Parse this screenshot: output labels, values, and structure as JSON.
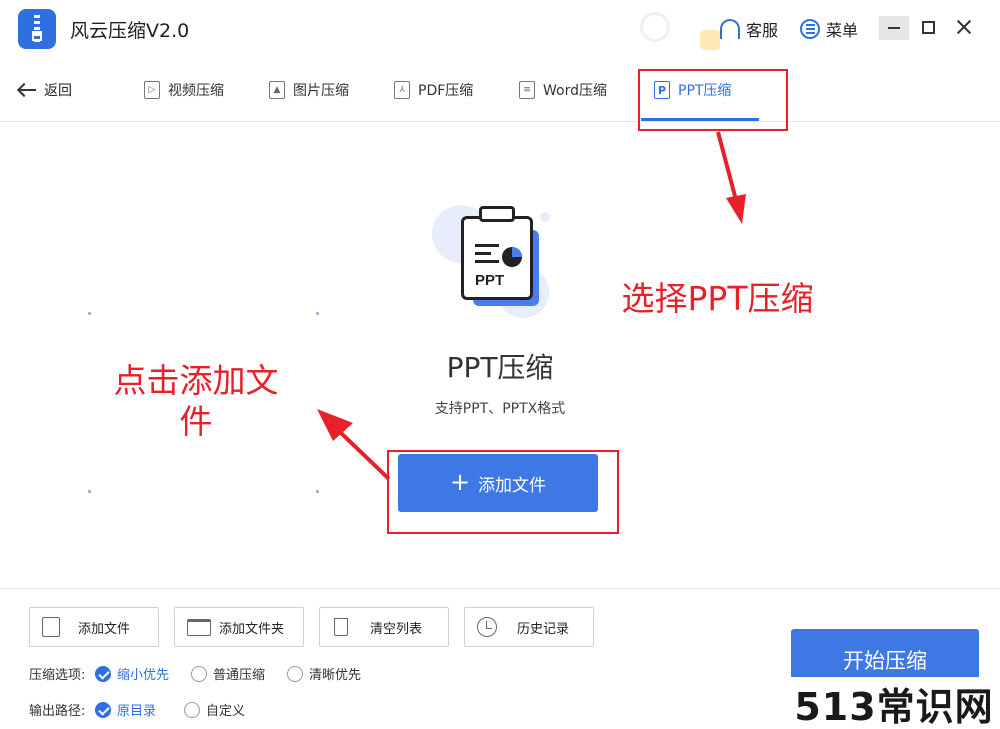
{
  "app": {
    "title": "风云压缩V2.0",
    "service_label": "客服",
    "menu_label": "菜单"
  },
  "nav": {
    "back_label": "返回",
    "tabs": [
      {
        "label": "视频压缩",
        "icon": "video-file-icon",
        "active": false
      },
      {
        "label": "图片压缩",
        "icon": "image-file-icon",
        "active": false
      },
      {
        "label": "PDF压缩",
        "icon": "pdf-file-icon",
        "active": false
      },
      {
        "label": "Word压缩",
        "icon": "word-file-icon",
        "active": false
      },
      {
        "label": "PPT压缩",
        "icon": "ppt-file-icon",
        "active": true
      }
    ]
  },
  "main": {
    "illustration_text": "PPT",
    "title": "PPT压缩",
    "subtitle": "支持PPT、PPTX格式",
    "add_file_label": "添加文件"
  },
  "annotations": {
    "select_ppt": "选择PPT压缩",
    "click_add": "点击添加文件"
  },
  "toolbar": {
    "add_file": "添加文件",
    "add_folder": "添加文件夹",
    "clear_list": "清空列表",
    "history": "历史记录"
  },
  "options": {
    "compress_label": "压缩选项:",
    "compress_choices": [
      {
        "label": "缩小优先",
        "checked": true
      },
      {
        "label": "普通压缩",
        "checked": false
      },
      {
        "label": "清晰优先",
        "checked": false
      }
    ],
    "output_label": "输出路径:",
    "output_choices": [
      {
        "label": "原目录",
        "checked": true
      },
      {
        "label": "自定义",
        "checked": false
      }
    ]
  },
  "start_label": "开始压缩",
  "watermark": "513常识网",
  "colors": {
    "primary": "#3d78e4",
    "accent_blue": "#2f6fe0",
    "annotation_red": "#e8202a"
  }
}
